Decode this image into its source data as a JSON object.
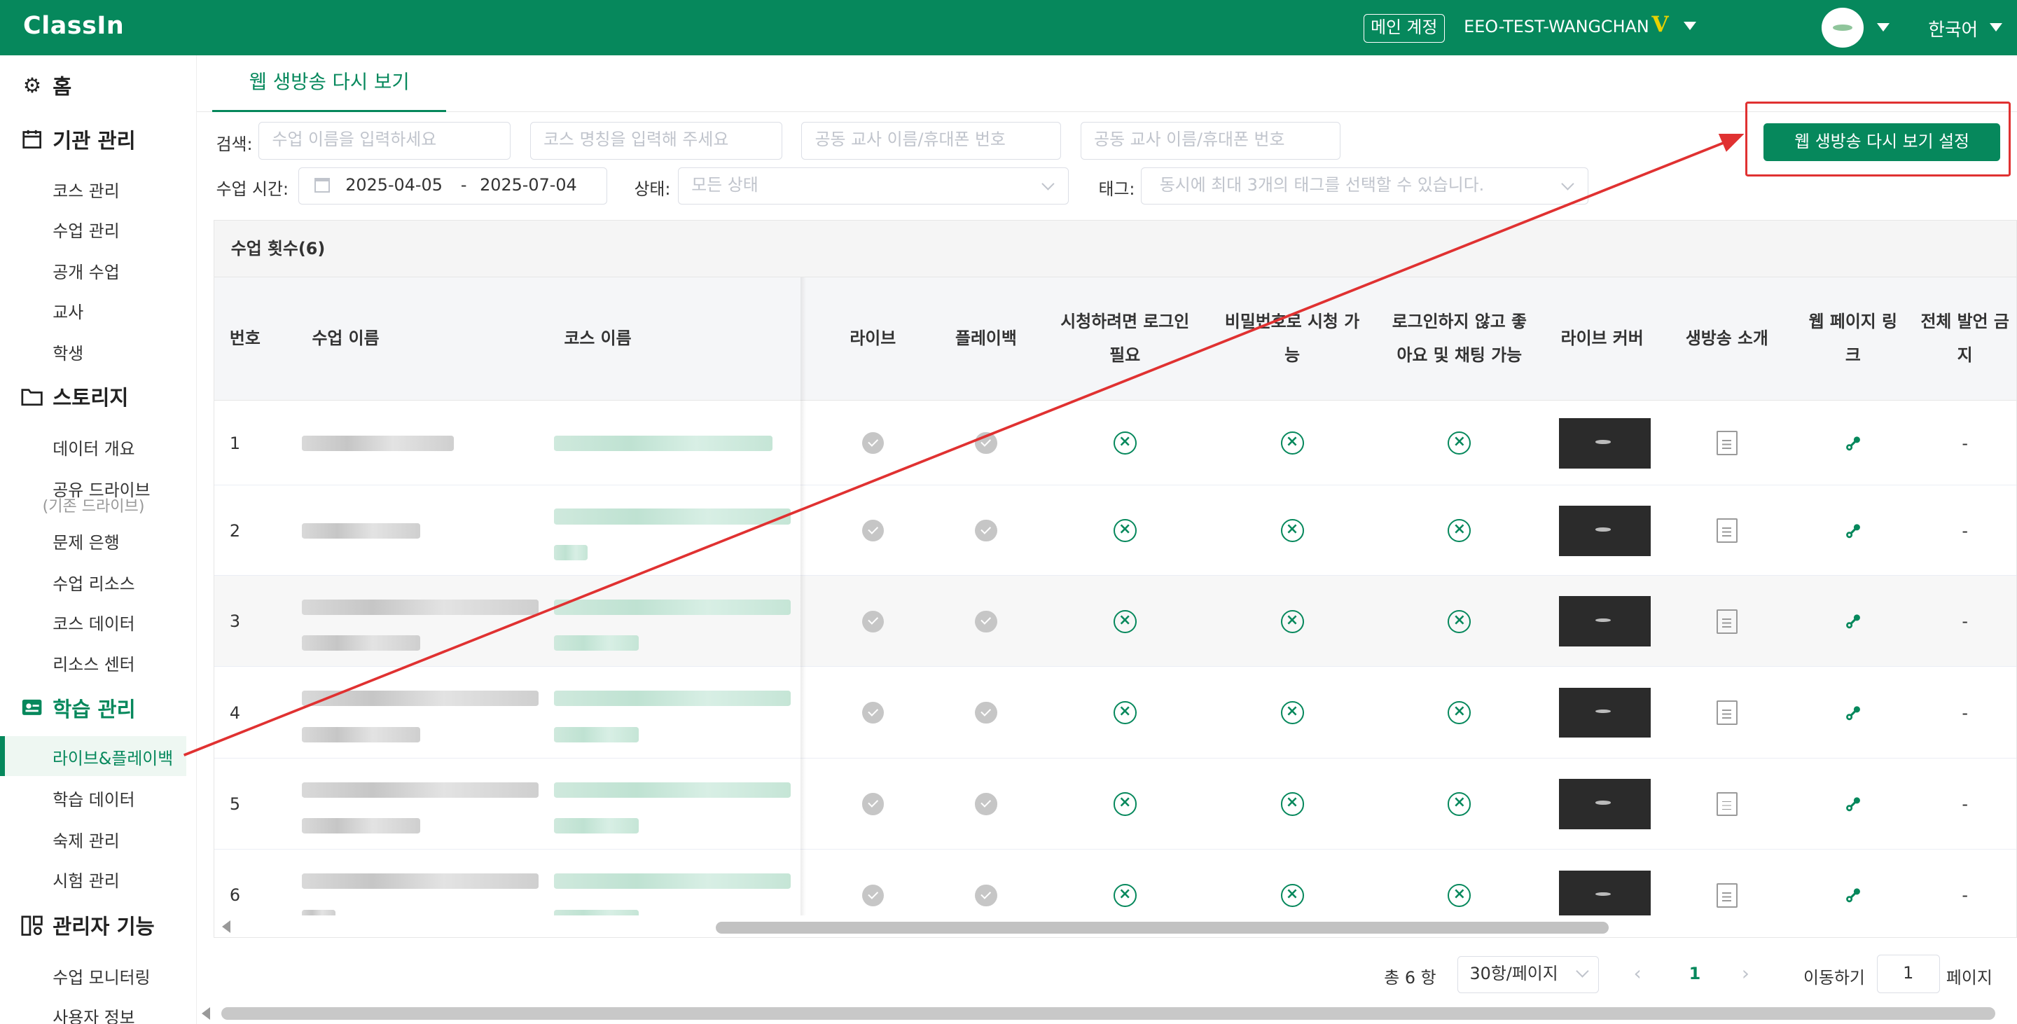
{
  "topbar": {
    "logo": "ClassIn",
    "main_account_label": "메인 계정",
    "account_name": "EEO-TEST-WANGCHAN",
    "badge": "V",
    "language": "한국어"
  },
  "sidebar": {
    "home": "홈",
    "institution": {
      "title": "기관 관리",
      "items": [
        "코스 관리",
        "수업 관리",
        "공개 수업",
        "교사",
        "학생"
      ]
    },
    "storage": {
      "title": "스토리지",
      "items": [
        "데이터 개요",
        "공유 드라이브",
        "(기존 드라이브)",
        "문제 은행",
        "수업 리소스",
        "코스 데이터",
        "리소스 센터"
      ]
    },
    "learning": {
      "title": "학습 관리",
      "items": [
        "라이브&플레이백",
        "학습 데이터",
        "숙제 관리",
        "시험 관리"
      ]
    },
    "admin": {
      "title": "관리자 기능",
      "items": [
        "수업 모니터링",
        "사용자 정보"
      ]
    }
  },
  "tab": {
    "label": "웹 생방송 다시 보기"
  },
  "filters": {
    "search_label": "검색:",
    "lesson_name_placeholder": "수업 이름을 입력하세요",
    "course_name_placeholder": "코스 명칭을 입력해 주세요",
    "coteacher_placeholder_1": "공동 교사 이름/휴대폰 번호",
    "coteacher_placeholder_2": "공동 교사 이름/휴대폰 번호",
    "time_label": "수업 시간:",
    "date_start": "2025-04-05",
    "date_sep": "-",
    "date_end": "2025-07-04",
    "status_label": "상태:",
    "status_placeholder": "모든 상태",
    "tag_label": "태그:",
    "tag_placeholder": "동시에 최대 3개의 태그를 선택할 수 있습니다."
  },
  "settings_button": "웹 생방송 다시 보기 설정",
  "table": {
    "count_label": "수업 횟수(6)",
    "headers": {
      "no": "번호",
      "lesson": "수업 이름",
      "course": "코스 이름",
      "live": "라이브",
      "playback": "플레이백",
      "login_required": "시청하려면 로그인 필요",
      "password": "비밀번호로 시청 가능",
      "no_login": "로그인하지 않고 좋아요 및 채팅 가능",
      "cover": "라이브 커버",
      "intro": "생방송 소개",
      "web_link": "웹 페이지 링크",
      "mute_all": "전체 발언 금지"
    },
    "rows": [
      {
        "no": "1",
        "live": "on",
        "playback": "on",
        "login_required": "off",
        "password": "off",
        "no_login": "off",
        "mute_all": "-"
      },
      {
        "no": "2",
        "live": "on",
        "playback": "on",
        "login_required": "off",
        "password": "off",
        "no_login": "off",
        "mute_all": "-"
      },
      {
        "no": "3",
        "live": "on",
        "playback": "on",
        "login_required": "off",
        "password": "off",
        "no_login": "off",
        "mute_all": "-"
      },
      {
        "no": "4",
        "live": "on",
        "playback": "on",
        "login_required": "off",
        "password": "off",
        "no_login": "off",
        "mute_all": "-"
      },
      {
        "no": "5",
        "live": "on",
        "playback": "on",
        "login_required": "off",
        "password": "off",
        "no_login": "off",
        "mute_all": "-"
      },
      {
        "no": "6",
        "live": "on",
        "playback": "on",
        "login_required": "off",
        "password": "off",
        "no_login": "off",
        "mute_all": "-"
      }
    ]
  },
  "pagination": {
    "total": "총 6 항",
    "page_size": "30항/페이지",
    "current_page": "1",
    "goto_label": "이동하기",
    "goto_value": "1",
    "page_suffix": "페이지"
  },
  "colors": {
    "brand": "#06885c",
    "annotation": "#e03131"
  }
}
